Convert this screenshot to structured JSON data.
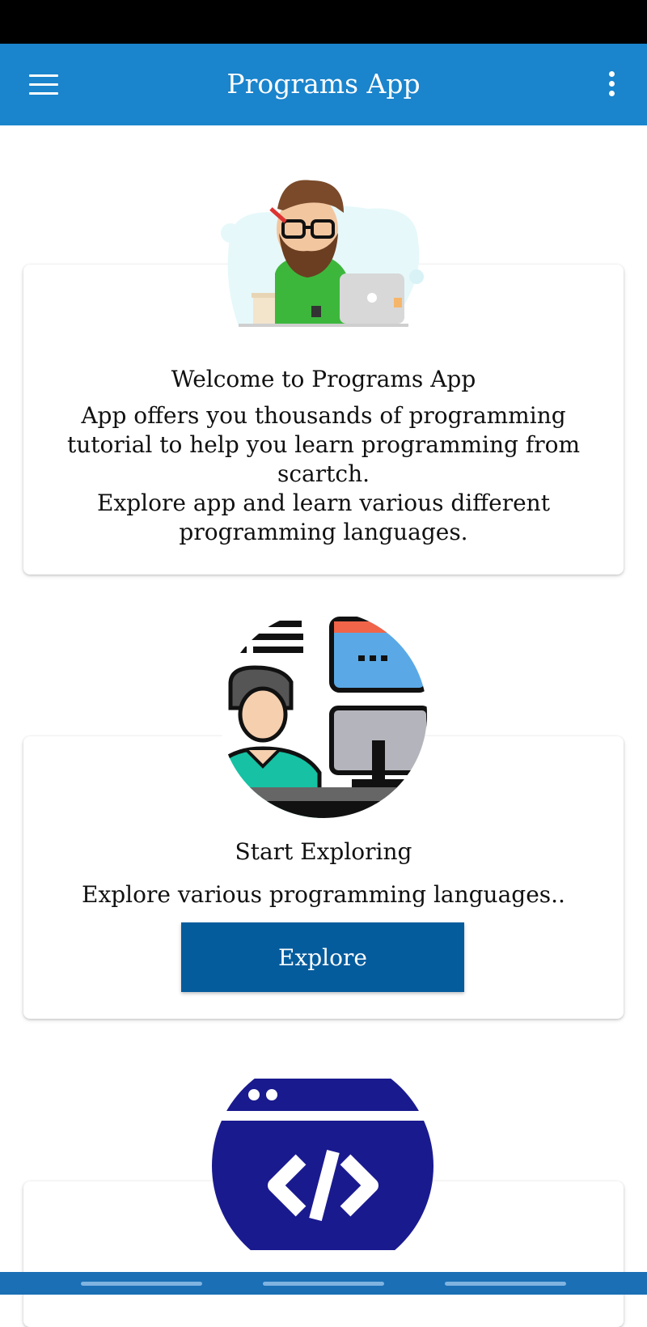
{
  "app_bar": {
    "title": "Programs App",
    "menu_icon": "hamburger-menu-icon",
    "more_icon": "more-vert-icon",
    "color": "#1a84cc"
  },
  "cards": [
    {
      "illustration": "developer-with-laptop-illustration",
      "title": "Welcome to Programs App",
      "body_line1": "App offers you thousands of programming tutorial to help you learn programming from scartch.",
      "body_line2": "Explore app and learn various different programming languages."
    },
    {
      "illustration": "programmer-at-computer-illustration",
      "title": "Start Exploring",
      "body": "Explore various programming languages..",
      "button_label": "Explore",
      "button_color": "#055c9d"
    },
    {
      "illustration": "code-window-icon"
    }
  ]
}
